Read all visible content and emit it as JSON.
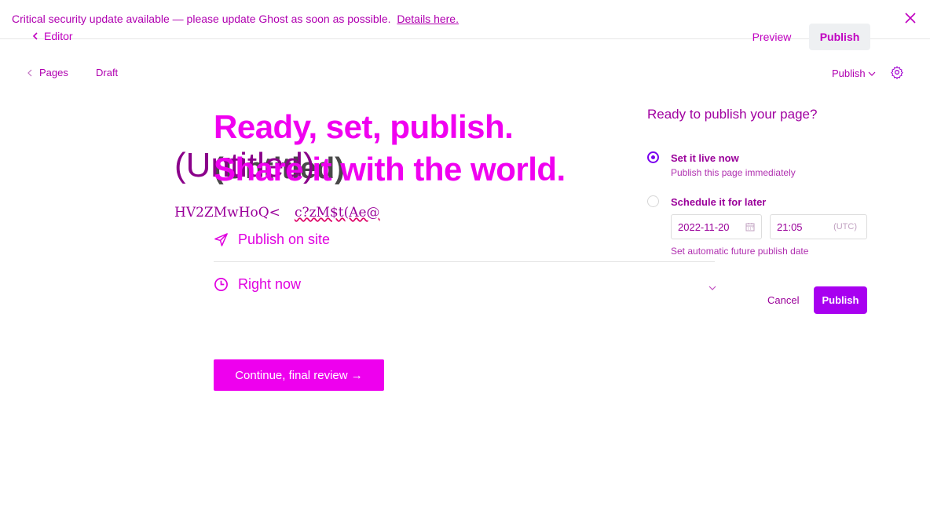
{
  "banner": {
    "message": "Critical security update available — please update Ghost as soon as possible.",
    "link_text": "Details here."
  },
  "topbar": {
    "back_label": "Editor",
    "preview_label": "Preview",
    "publish_label": "Publish"
  },
  "breadcrumb": {
    "pages_label": "Pages",
    "status_label": "Draft",
    "publish_menu_label": "Publish"
  },
  "flow": {
    "headline_line1": "Ready, set, publish.",
    "headline_line2": "Share it with the world.",
    "underlay_title": "(Untitled)",
    "underlay_title_ghost": "(Untitled)",
    "garbled_text_1": "HV2ZMwHoQ<",
    "garbled_text_2": "c?zM$t(Ae@",
    "publish_on_label": "Publish on site",
    "timing_label": "Right now",
    "continue_label": "Continue, final review →"
  },
  "schedule_popover": {
    "title": "Ready to publish your page?",
    "option_now_label": "Set it live now",
    "option_now_sub": "Publish this page immediately",
    "option_later_label": "Schedule it for later",
    "date_value": "2022-11-20",
    "time_value": "21:05",
    "timezone": "(UTC)",
    "hint": "Set automatic future publish date",
    "cancel_label": "Cancel",
    "publish_label": "Publish",
    "selected": "now"
  },
  "colors": {
    "accent": "#ee00ee",
    "primary_button": "#a800f0",
    "radio_selected": "#7a00ee"
  }
}
